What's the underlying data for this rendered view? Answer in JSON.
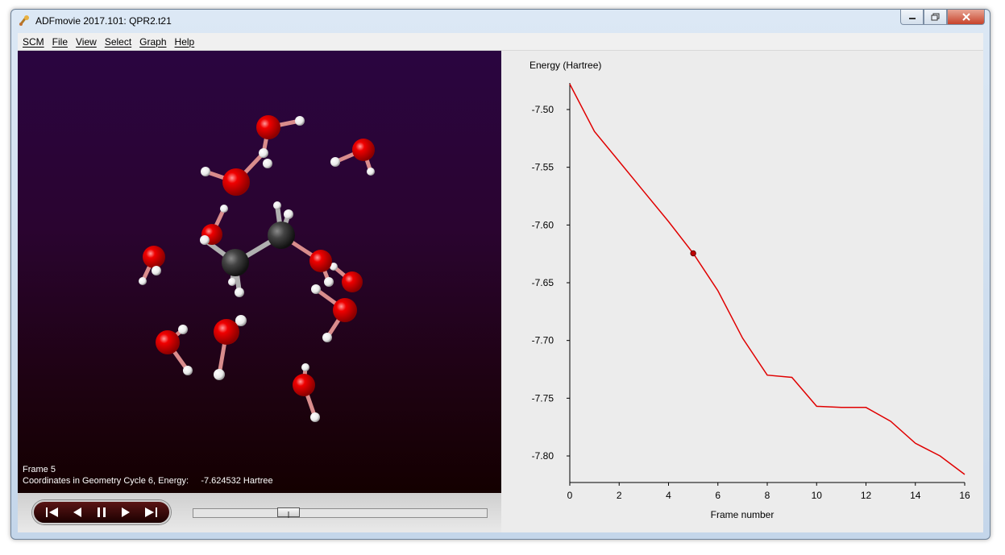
{
  "window": {
    "title": "ADFmovie 2017.101: QPR2.t21",
    "controls": [
      "minimize",
      "maximize",
      "close"
    ]
  },
  "menu": [
    "SCM",
    "File",
    "View",
    "Select",
    "Graph",
    "Help"
  ],
  "viewer": {
    "frame_label": "Frame 5",
    "status_line": "Coordinates in Geometry Cycle 6, Energy:     -7.624532 Hartree"
  },
  "playback": {
    "buttons": [
      "first-frame",
      "previous-frame",
      "pause",
      "next-frame",
      "last-frame"
    ],
    "slider_fraction": 0.31
  },
  "colors": {
    "oxygen": "#e00000",
    "hydrogen": "#ffffff",
    "carbon": "#3a3a3a",
    "curve": "#e00000"
  },
  "chart_data": {
    "type": "line",
    "ylabel": "Energy (Hartree)",
    "xlabel": "Frame number",
    "xlim": [
      0,
      16
    ],
    "ylim": [
      -7.823,
      -7.477
    ],
    "x_ticks": [
      "0",
      "2",
      "4",
      "6",
      "8",
      "10",
      "12",
      "14",
      "16"
    ],
    "y_ticks": [
      "-7.50",
      "-7.55",
      "-7.60",
      "-7.65",
      "-7.70",
      "-7.75",
      "-7.80"
    ],
    "x": [
      0,
      1,
      2,
      3,
      4,
      5,
      6,
      7,
      8,
      9,
      10,
      11,
      12,
      13,
      14,
      15,
      16
    ],
    "y": [
      -7.478,
      -7.519,
      -7.545,
      -7.571,
      -7.597,
      -7.6245,
      -7.657,
      -7.698,
      -7.73,
      -7.732,
      -7.757,
      -7.758,
      -7.758,
      -7.77,
      -7.789,
      -7.8,
      -7.816
    ],
    "current_frame": 5,
    "current_value": -7.624532
  }
}
